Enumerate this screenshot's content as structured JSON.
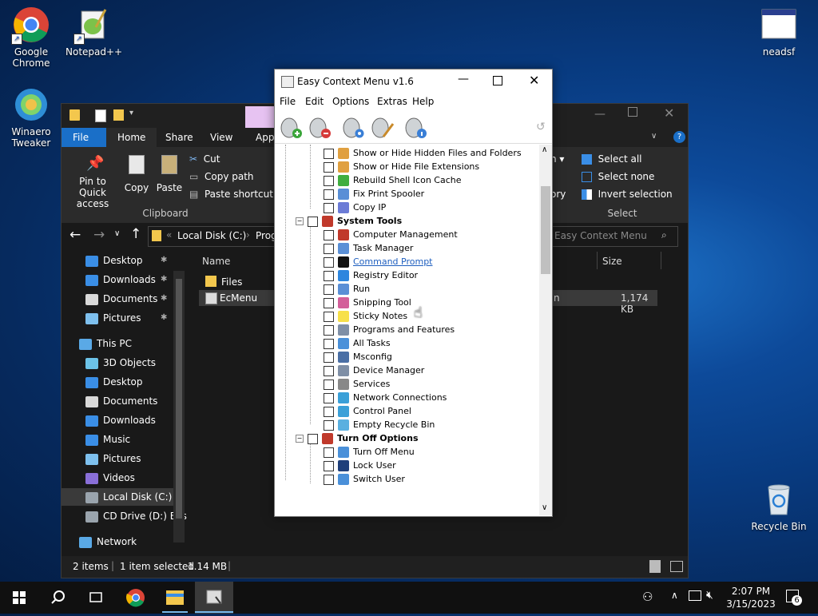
{
  "desktop": {
    "icons": [
      {
        "label_line1": "Google",
        "label_line2": "Chrome"
      },
      {
        "label_line1": "Notepad++",
        "label_line2": ""
      },
      {
        "label_line1": "Winaero",
        "label_line2": "Tweaker"
      },
      {
        "label_line1": "neadsf",
        "label_line2": ""
      },
      {
        "label_line1": "Recycle Bin",
        "label_line2": ""
      }
    ]
  },
  "explorer": {
    "tabs": [
      "File",
      "Home",
      "Share",
      "View",
      "Appl"
    ],
    "ribbon": {
      "pin_label_1": "Pin to Quick",
      "pin_label_2": "access",
      "copy_label": "Copy",
      "paste_label": "Paste",
      "cut_label": "Cut",
      "copy_path_label": "Copy path",
      "paste_shortcut_label": "Paste shortcut",
      "clipboard_group": "Clipboard",
      "open_partial": "n",
      "history_partial": "ory",
      "select_all_label": "Select all",
      "select_none_label": "Select none",
      "invert_selection_label": "Invert selection",
      "select_group": "Select"
    },
    "address": {
      "path_1": "Local Disk (C:)",
      "path_2": "Prog",
      "search_placeholder": "Easy Context Menu"
    },
    "nav": [
      {
        "label": "Desktop",
        "pinned": true,
        "color": "#3a8ee6"
      },
      {
        "label": "Downloads",
        "pinned": true,
        "color": "#3a8ee6"
      },
      {
        "label": "Documents",
        "pinned": true,
        "color": "#d9d9d9"
      },
      {
        "label": "Pictures",
        "pinned": true,
        "color": "#7ec0ee"
      },
      {
        "label": "This PC",
        "pinned": false,
        "color": "#5aa9e6"
      },
      {
        "label": "3D Objects",
        "pinned": false,
        "color": "#6cc3e8"
      },
      {
        "label": "Desktop",
        "pinned": false,
        "color": "#3a8ee6"
      },
      {
        "label": "Documents",
        "pinned": false,
        "color": "#d9d9d9"
      },
      {
        "label": "Downloads",
        "pinned": false,
        "color": "#3a8ee6"
      },
      {
        "label": "Music",
        "pinned": false,
        "color": "#3a8ee6"
      },
      {
        "label": "Pictures",
        "pinned": false,
        "color": "#7ec0ee"
      },
      {
        "label": "Videos",
        "pinned": false,
        "color": "#8a6fd8"
      },
      {
        "label": "Local Disk (C:)",
        "pinned": false,
        "color": "#9aa4ad"
      },
      {
        "label": "CD Drive (D:) Eas",
        "pinned": false,
        "color": "#9aa4ad"
      },
      {
        "label": "Network",
        "pinned": false,
        "color": "#5aa9e6"
      }
    ],
    "columns": {
      "name": "Name",
      "size": "Size"
    },
    "files": [
      {
        "name": "Files",
        "size": "",
        "type_partial": ""
      },
      {
        "name": "EcMenu",
        "size": "1,174 KB",
        "type_partial": "n"
      }
    ],
    "status": {
      "items": "2 items",
      "selected": "1 item selected",
      "size": "1.14 MB"
    }
  },
  "dialog": {
    "title": "Easy Context Menu v1.6",
    "menu": [
      "File",
      "Edit",
      "Options",
      "Extras",
      "Help"
    ],
    "rows": [
      {
        "kind": "item",
        "label": "Show or Hide Hidden Files and Folders",
        "icon": "#e0a040"
      },
      {
        "kind": "item",
        "label": "Show or Hide File Extensions",
        "icon": "#e0a040"
      },
      {
        "kind": "item",
        "label": "Rebuild Shell Icon Cache",
        "icon": "#3fae3f"
      },
      {
        "kind": "item",
        "label": "Fix Print Spooler",
        "icon": "#5a8fd6"
      },
      {
        "kind": "item",
        "label": "Copy IP",
        "icon": "#6b7bd6"
      },
      {
        "kind": "group",
        "label": "System Tools",
        "icon": "#c0392b"
      },
      {
        "kind": "item",
        "label": "Computer Management",
        "icon": "#c0392b"
      },
      {
        "kind": "item",
        "label": "Task Manager",
        "icon": "#5a8fd6"
      },
      {
        "kind": "link",
        "label": "Command Prompt",
        "icon": "#111111"
      },
      {
        "kind": "item",
        "label": "Registry Editor",
        "icon": "#2e86de"
      },
      {
        "kind": "item",
        "label": "Run",
        "icon": "#5a8fd6"
      },
      {
        "kind": "item",
        "label": "Snipping Tool",
        "icon": "#d35f9a"
      },
      {
        "kind": "item",
        "label": "Sticky Notes",
        "icon": "#f7e04a"
      },
      {
        "kind": "item",
        "label": "Programs and Features",
        "icon": "#7f8fa6"
      },
      {
        "kind": "item",
        "label": "All Tasks",
        "icon": "#4a90d9"
      },
      {
        "kind": "item",
        "label": "Msconfig",
        "icon": "#4a6fa5"
      },
      {
        "kind": "item",
        "label": "Device Manager",
        "icon": "#7f8fa6"
      },
      {
        "kind": "item",
        "label": "Services",
        "icon": "#888888"
      },
      {
        "kind": "item",
        "label": "Network Connections",
        "icon": "#3aa0d8"
      },
      {
        "kind": "item",
        "label": "Control Panel",
        "icon": "#3aa0d8"
      },
      {
        "kind": "item",
        "label": "Empty Recycle Bin",
        "icon": "#5ab0e0"
      },
      {
        "kind": "group",
        "label": "Turn Off Options",
        "icon": "#c0392b"
      },
      {
        "kind": "item",
        "label": "Turn Off Menu",
        "icon": "#4a90d9"
      },
      {
        "kind": "item",
        "label": "Lock User",
        "icon": "#1f3f7a"
      },
      {
        "kind": "item",
        "label": "Switch User",
        "icon": "#4a90d9"
      }
    ]
  },
  "taskbar": {
    "time": "2:07 PM",
    "date": "3/15/2023",
    "notification_count": "6"
  },
  "colors": {
    "accent": "#0078d7",
    "link": "#1f5fbf"
  }
}
